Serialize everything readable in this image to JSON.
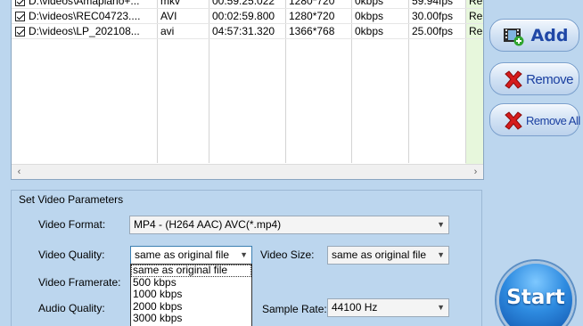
{
  "files": [
    {
      "path": "D:\\videos\\Amapiano+...",
      "format": "mkv",
      "duration": "00:59:25.022",
      "resolution": "1280*720",
      "bitrate": "0kbps",
      "fps": "59.94fps",
      "status": "Re..."
    },
    {
      "path": "D:\\videos\\REC04723....",
      "format": "AVI",
      "duration": "00:02:59.800",
      "resolution": "1280*720",
      "bitrate": "0kbps",
      "fps": "30.00fps",
      "status": "Re..."
    },
    {
      "path": "D:\\videos\\LP_202108...",
      "format": "avi",
      "duration": "04:57:31.320",
      "resolution": "1366*768",
      "bitrate": "0kbps",
      "fps": "25.00fps",
      "status": "Re..."
    }
  ],
  "scroll": {
    "left": "‹",
    "right": "›"
  },
  "params": {
    "title": "Set Video Parameters",
    "video_format_label": "Video Format:",
    "video_format_value": "MP4 - (H264 AAC) AVC(*.mp4)",
    "video_quality_label": "Video Quality:",
    "video_quality_value": "same as original file",
    "video_size_label": "Video Size:",
    "video_size_value": "same as original file",
    "video_framerate_label": "Video Framerate:",
    "audio_quality_label": "Audio Quality:",
    "sample_rate_label": "Sample Rate:",
    "sample_rate_value": "44100 Hz",
    "quality_options": [
      "same as original file",
      "500 kbps",
      "1000 kbps",
      "2000 kbps",
      "3000 kbps"
    ]
  },
  "buttons": {
    "add": "Add",
    "remove": "Remove",
    "remove_all": "Remove All",
    "start": "Start"
  },
  "icons": {
    "add": "film-add-icon",
    "remove": "red-x-icon",
    "remove_all": "red-x-stack-icon",
    "caret": "chevron-down-icon"
  }
}
